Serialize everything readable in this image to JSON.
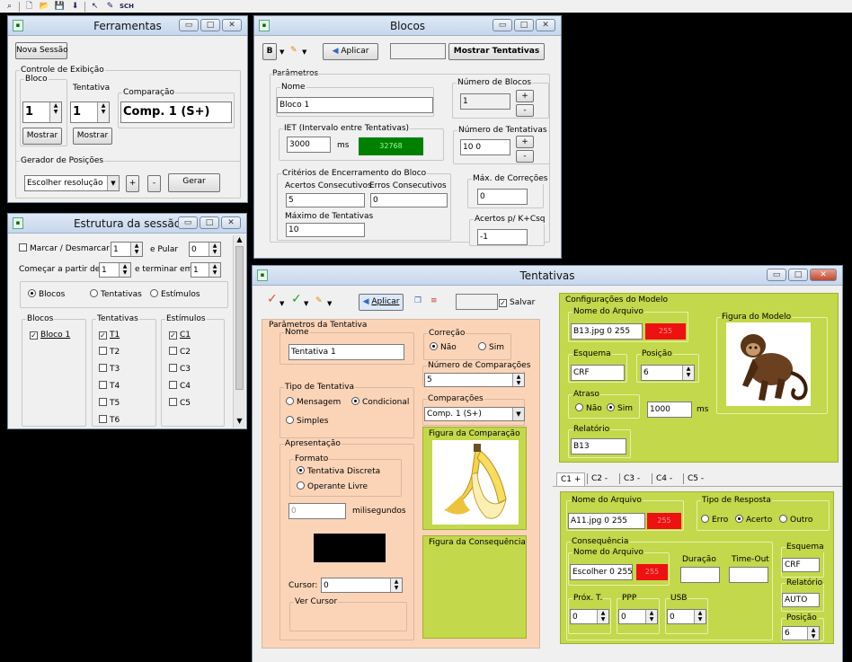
{
  "toolbar": {
    "icons": [
      "search-icon",
      "new-file-icon",
      "open-folder-icon",
      "save-icon",
      "download-icon",
      "cursor-icon",
      "pencil-icon"
    ],
    "label_sch": "SCH"
  },
  "ferramentas": {
    "title": "Ferramentas",
    "nova_sessao": "Nova Sessão",
    "controle": "Controle de Exibição",
    "bloco": "Bloco",
    "tentativa": "Tentativa",
    "comparacao": "Comparação",
    "bloco_val": "1",
    "tentativa_val": "1",
    "comparacao_val": "Comp. 1 (S+)",
    "mostrar": "Mostrar",
    "gerador": "Gerador de Posições",
    "escolher": "Escolher resolução",
    "plus": "+",
    "minus": "-",
    "gerar": "Gerar"
  },
  "estrutura": {
    "title": "Estrutura da sessão",
    "marcar": "Marcar / Desmarcar",
    "marcar_val": "1",
    "e_pular": "e Pular",
    "pular_val": "0",
    "comecar": "Começar a partir de",
    "comecar_val": "1",
    "terminar": "e terminar em",
    "terminar_val": "1",
    "radios": [
      "Blocos",
      "Tentativas",
      "Estímulos"
    ],
    "blocos_h": "Blocos",
    "tentativas_h": "Tentativas",
    "estimulos_h": "Estímulos",
    "blocos": [
      "Bloco 1"
    ],
    "tentativas": [
      "T1",
      "T2",
      "T3",
      "T4",
      "T5",
      "T6"
    ],
    "estimulos": [
      "C1",
      "C2",
      "C3",
      "C4",
      "C5"
    ]
  },
  "blocos": {
    "title": "Blocos",
    "b": "B",
    "aplicar": "Aplicar",
    "mostrar_tentativas": "Mostrar Tentativas",
    "parametros": "Parâmetros",
    "nome": "Nome",
    "nome_val": "Bloco 1",
    "num_blocos": "Número de Blocos",
    "num_blocos_val": "1",
    "iet": "IET (Intervalo entre Tentativas)",
    "iet_val": "3000",
    "ms": "ms",
    "color_val": "32768",
    "num_tent": "Número de Tentativas",
    "num_tent_val": "10 0",
    "criterios": "Critérios de Encerramento do Bloco",
    "acertos_consec": "Acertos Consecutivos",
    "acertos_val": "5",
    "erros_consec": "Erros Consecutivos",
    "erros_val": "0",
    "max_tent": "Máximo de Tentativas",
    "max_tent_val": "10",
    "max_corr": "Máx. de Correções",
    "max_corr_val": "0",
    "acertos_k": "Acertos p/ K+Csq",
    "acertos_k_val": "-1",
    "plus": "+",
    "minus": "-"
  },
  "tentativas": {
    "title": "Tentativas",
    "aplicar": "Aplicar",
    "salvar": "Salvar",
    "params": "Parâmetros da Tentativa",
    "nome": "Nome",
    "nome_val": "Tentativa 1",
    "correcao": "Correção",
    "nao": "Não",
    "sim": "Sim",
    "num_comp": "Número de Comparações",
    "num_comp_val": "5",
    "tipo": "Tipo de Tentativa",
    "mensagem": "Mensagem",
    "condicional": "Condicional",
    "simples": "Simples",
    "comparacoes": "Comparações",
    "comparacoes_val": "Comp. 1 (S+)",
    "apresentacao": "Apresentação",
    "formato": "Formato",
    "discreta": "Tentativa Discreta",
    "operante": "Operante Livre",
    "ms_val": "0",
    "milisegundos": "milisegundos",
    "fig_comp": "Figura da Comparação",
    "fig_consq": "Figura da Consequência",
    "cursor": "Cursor:",
    "cursor_val": "0",
    "ver_cursor": "Ver Cursor",
    "config_modelo": "Configurações do Modelo",
    "nome_arquivo": "Nome do Arquivo",
    "arquivo_val": "B13.jpg 0 255",
    "n255": "255",
    "fig_modelo": "Figura do Modelo",
    "esquema": "Esquema",
    "esquema_val": "CRF",
    "posicao": "Posição",
    "posicao_val": "6",
    "atraso": "Atraso",
    "atraso_val": "1000",
    "ms": "ms",
    "relatorio": "Relatório",
    "relatorio_val": "B13",
    "tabs": [
      "C1 +",
      "C2 -",
      "C3 -",
      "C4 -",
      "C5 -"
    ],
    "c_arquivo_val": "A11.jpg 0 255",
    "tipo_resposta": "Tipo de Resposta",
    "erro": "Erro",
    "acerto": "Acerto",
    "outro": "Outro",
    "consequencia": "Consequência",
    "consq_arquivo_val": "Escolher 0 255",
    "duracao": "Duração",
    "timeout": "Time-Out",
    "prox_t": "Próx. T.",
    "ppp": "PPP",
    "usb": "USB",
    "zero": "0",
    "c_esquema_val": "CRF",
    "c_relatorio_val": "AUTO",
    "c_posicao_val": "6"
  },
  "colors": {
    "green_panel": "#c3d84a",
    "peach_panel": "#fbd4b8",
    "red_swatch": "#ee1111",
    "green_swatch": "#008000"
  }
}
